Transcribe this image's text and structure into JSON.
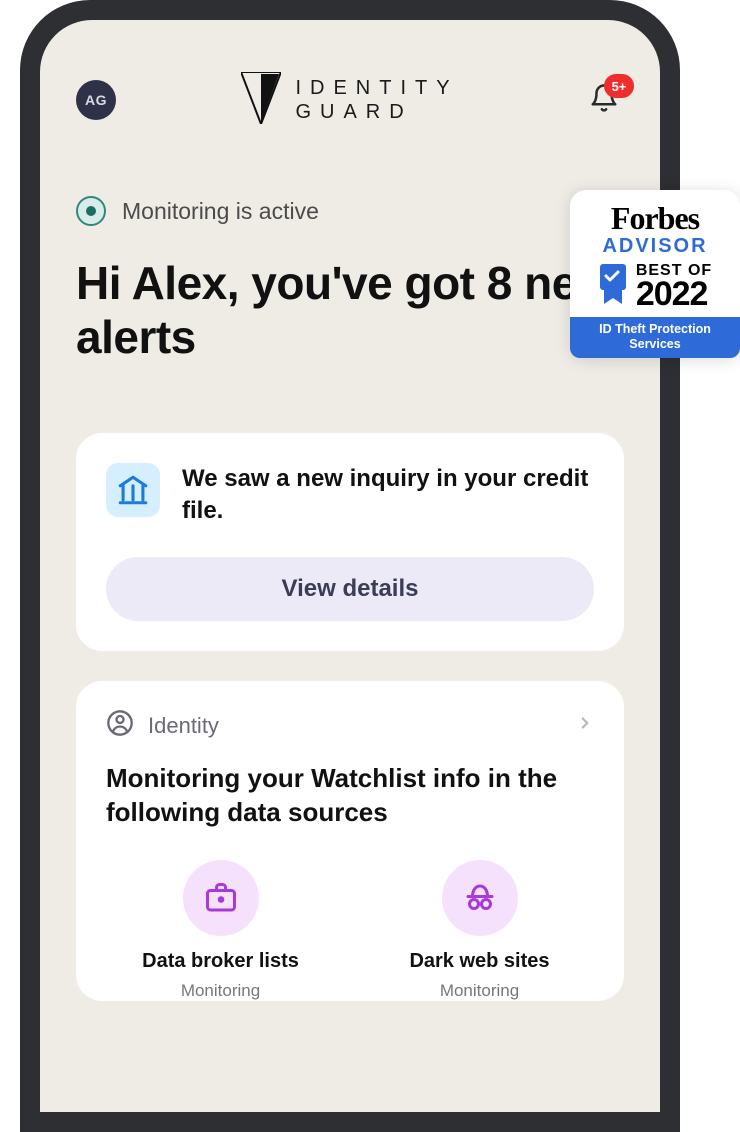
{
  "header": {
    "avatar_initials": "AG",
    "brand_line1": "IDENTITY",
    "brand_line2": "GUARD",
    "notification_badge": "5+"
  },
  "status": {
    "text": "Monitoring is active"
  },
  "headline": "Hi Alex, you've got 8 new alerts",
  "alert_card": {
    "message": "We saw a new inquiry in your credit file.",
    "button_label": "View details"
  },
  "identity_card": {
    "section_label": "Identity",
    "heading": "Monitoring your Watchlist info in the following data sources",
    "sources": [
      {
        "name": "Data broker lists",
        "status": "Monitoring",
        "icon": "briefcase-icon"
      },
      {
        "name": "Dark web sites",
        "status": "Monitoring",
        "icon": "incognito-icon"
      }
    ]
  },
  "forbes_badge": {
    "brand": "Forbes",
    "sub": "ADVISOR",
    "bestof": "BEST OF",
    "year": "2022",
    "strip": "ID Theft Protection Services"
  }
}
